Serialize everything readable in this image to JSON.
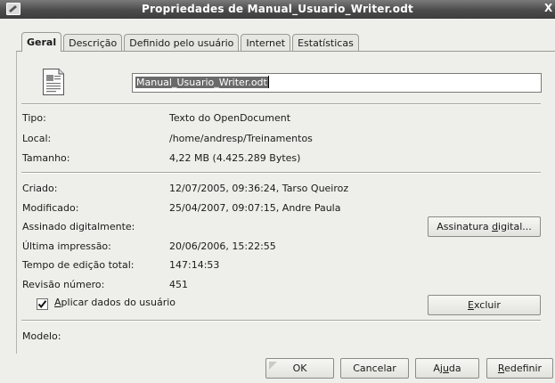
{
  "window": {
    "title": "Propriedades de Manual_Usuario_Writer.odt",
    "close_glyph": "X"
  },
  "tabs": [
    {
      "label": "Geral",
      "active": true
    },
    {
      "label": "Descrição",
      "active": false
    },
    {
      "label": "Definido pelo usuário",
      "active": false
    },
    {
      "label": "Internet",
      "active": false
    },
    {
      "label": "Estatísticas",
      "active": false
    }
  ],
  "filename": {
    "value": "Manual_Usuario_Writer.odt"
  },
  "file_info": {
    "type_label": "Tipo:",
    "type_value": "Texto do OpenDocument",
    "location_label": "Local:",
    "location_value": "/home/andresp/Treinamentos",
    "size_label": "Tamanho:",
    "size_value": "4,22 MB (4.425.289 Bytes)"
  },
  "doc_info": {
    "created_label": "Criado:",
    "created_value": "12/07/2005, 09:36:24, Tarso Queiroz",
    "modified_label": "Modificado:",
    "modified_value": "25/04/2007, 09:07:15, Andre Paula",
    "signed_label": "Assinado digitalmente:",
    "printed_label": "Última impressão:",
    "printed_value": "20/06/2006, 15:22:55",
    "edit_time_label": "Tempo de edição total:",
    "edit_time_value": "147:14:53",
    "revision_label": "Revisão número:",
    "revision_value": "451"
  },
  "buttons": {
    "signature_pre": "Assinatura ",
    "signature_mn": "d",
    "signature_post": "igital...",
    "delete_pre": "",
    "delete_mn": "E",
    "delete_post": "xcluir",
    "ok": "OK",
    "cancel": "Cancelar",
    "help_pre": "Aj",
    "help_mn": "u",
    "help_post": "da",
    "reset_pre": "",
    "reset_mn": "R",
    "reset_post": "edefinir"
  },
  "apply_user_data": {
    "checked": true,
    "label_mn": "A",
    "label_post": "plicar dados do usuário"
  },
  "template": {
    "label": "Modelo:"
  }
}
